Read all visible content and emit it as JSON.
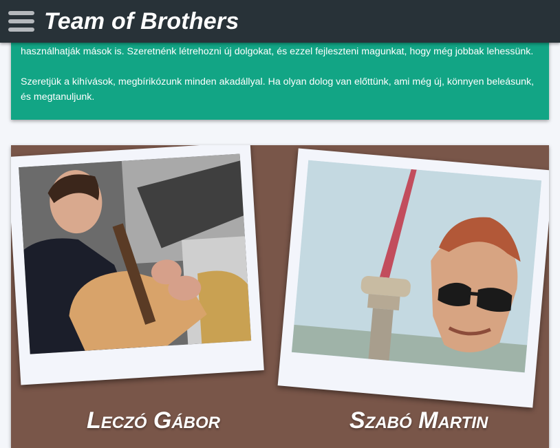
{
  "header": {
    "title": "Team of Brothers",
    "menu_icon": "hamburger-menu-icon"
  },
  "intro": {
    "paragraph1": "használhatják mások is. Szeretnénk létrehozni új dolgokat, és ezzel fejleszteni magunkat, hogy még jobbak lehessünk.",
    "paragraph2": "Szeretjük a kihívások, megbírikózunk minden akadállyal. Ha olyan dolog van előttünk, ami még új, könnyen beleásunk, és megtanuljunk."
  },
  "members": [
    {
      "name": "Leczó Gábor"
    },
    {
      "name": "Szabó Martin"
    }
  ],
  "colors": {
    "header_bg": "#283238",
    "intro_bg": "#12a585",
    "team_bg": "#795649",
    "polaroid": "#f3f5fb"
  }
}
